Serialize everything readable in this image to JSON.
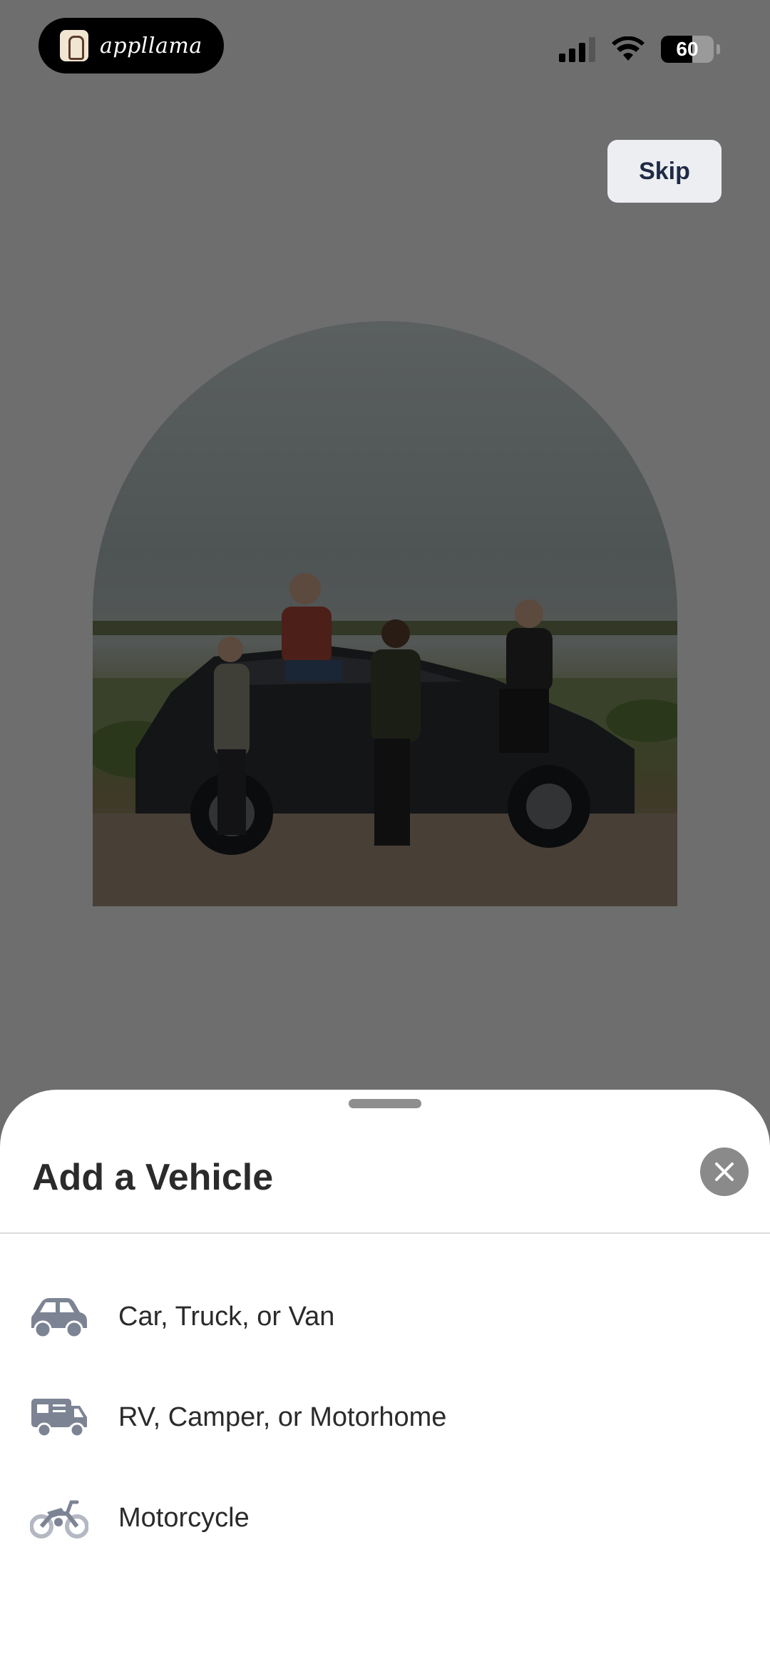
{
  "status_bar": {
    "app_badge": "appllama",
    "battery": "60"
  },
  "header": {
    "skip_label": "Skip"
  },
  "sheet": {
    "title": "Add a Vehicle",
    "options": [
      {
        "label": "Car, Truck, or Van",
        "icon": "car-icon"
      },
      {
        "label": "RV, Camper, or Motorhome",
        "icon": "rv-icon"
      },
      {
        "label": "Motorcycle",
        "icon": "motorcycle-icon"
      }
    ]
  },
  "colors": {
    "icon_gray": "#7c8494",
    "sheet_bg": "#ffffff",
    "overlay": "#6b6b6b"
  }
}
